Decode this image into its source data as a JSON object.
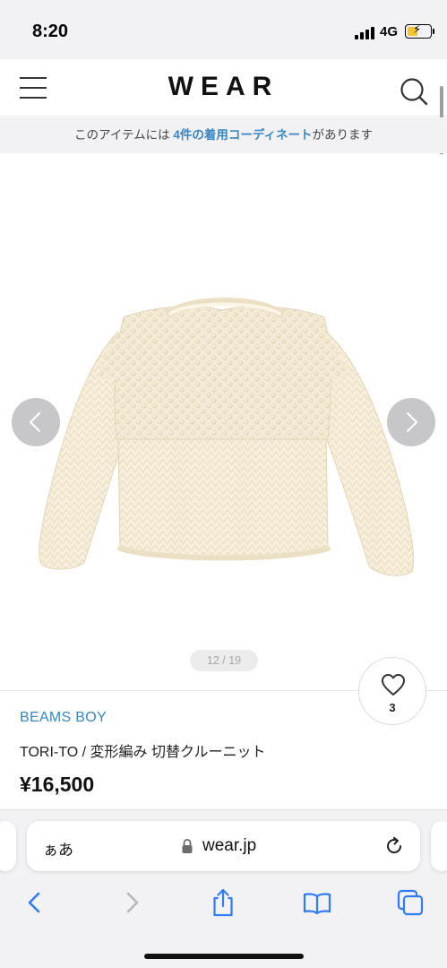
{
  "status_bar": {
    "time": "8:20",
    "network": "4G",
    "battery_charging_glyph": "⚡"
  },
  "header": {
    "logo": "WEAR"
  },
  "coord_banner": {
    "prefix": "このアイテムには ",
    "link": "4件の着用コーディネート",
    "suffix": "があります"
  },
  "carousel": {
    "pager": "12 / 19"
  },
  "favorite": {
    "count": "3"
  },
  "product": {
    "brand": "BEAMS BOY",
    "name": "TORI-TO / 変形編み 切替クルーニット",
    "price": "¥16,500"
  },
  "safari": {
    "aa_label": "ぁあ",
    "url": "wear.jp"
  },
  "colors": {
    "accent": "#3a86c4",
    "safari_blue": "#2f7cf6"
  }
}
